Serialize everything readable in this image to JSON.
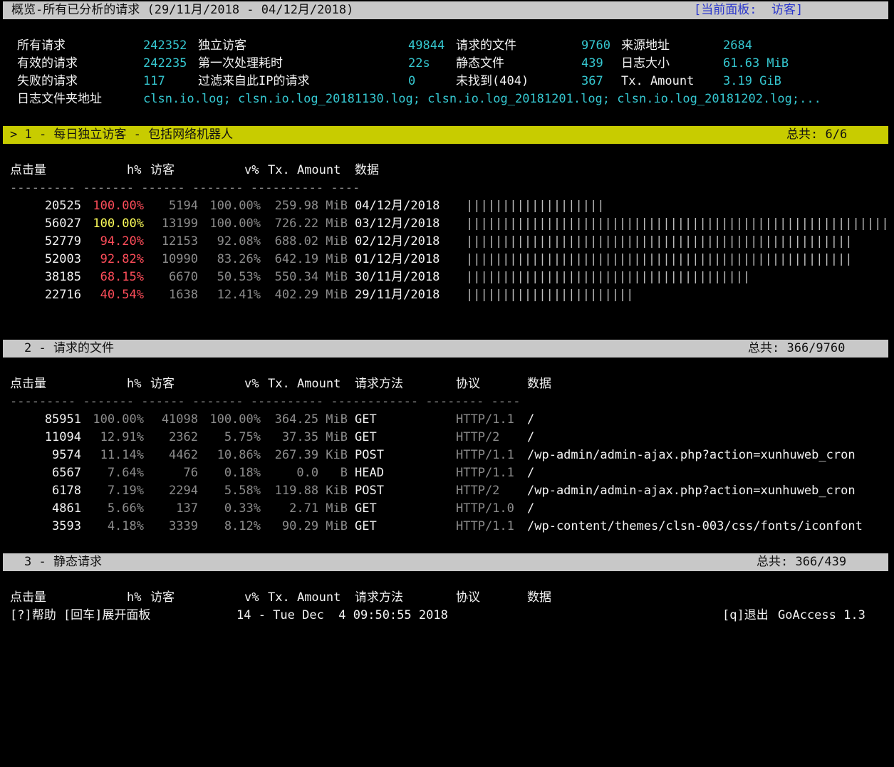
{
  "header": {
    "title": "概览-所有已分析的请求 (29/11月/2018 - 04/12月/2018)",
    "panel_label": "[当前面板:  访客]"
  },
  "overview": {
    "rows": [
      [
        {
          "label": "所有请求",
          "value": "242352"
        },
        {
          "label": "独立访客",
          "value": "49844"
        },
        {
          "label": "请求的文件",
          "value": "9760"
        },
        {
          "label": "来源地址",
          "value": "2684"
        }
      ],
      [
        {
          "label": "有效的请求",
          "value": "242235"
        },
        {
          "label": "第一次处理耗时",
          "value": "22s"
        },
        {
          "label": "静态文件",
          "value": "439"
        },
        {
          "label": "日志大小",
          "value": "61.63 MiB"
        }
      ],
      [
        {
          "label": "失败的请求",
          "value": "117"
        },
        {
          "label": "过滤来自此IP的请求",
          "value": "0"
        },
        {
          "label": "未找到(404)",
          "value": "367"
        },
        {
          "label": "Tx. Amount",
          "value": "3.19 GiB"
        }
      ]
    ],
    "log_label": "日志文件夹地址",
    "log_value": "clsn.io.log; clsn.io.log_20181130.log; clsn.io.log_20181201.log; clsn.io.log_20181202.log;..."
  },
  "panel1": {
    "title": "> 1 - 每日独立访客 - 包括网络机器人",
    "total": "总共: 6/6",
    "headers": {
      "hits": "点击量",
      "hpct": "h%",
      "visitors": "访客",
      "vpct": "v%",
      "tx": "Tx. Amount",
      "data": "数据"
    },
    "dashes": "--------- ------- ------ ------- ---------- ----",
    "rows": [
      {
        "hits": "20525",
        "hpct": "100.00%",
        "visitors": "5194",
        "vpct": "100.00%",
        "tx": "259.98 MiB",
        "date": "04/12月/2018",
        "bar": 0.33,
        "hcolor": "red"
      },
      {
        "hits": "56027",
        "hpct": "100.00%",
        "visitors": "13199",
        "vpct": "100.00%",
        "tx": "726.22 MiB",
        "date": "03/12月/2018",
        "bar": 1.0,
        "hcolor": "yellow"
      },
      {
        "hits": "52779",
        "hpct": "94.20%",
        "visitors": "12153",
        "vpct": "92.08%",
        "tx": "688.02 MiB",
        "date": "02/12月/2018",
        "bar": 0.92,
        "hcolor": "red"
      },
      {
        "hits": "52003",
        "hpct": "92.82%",
        "visitors": "10990",
        "vpct": "83.26%",
        "tx": "642.19 MiB",
        "date": "01/12月/2018",
        "bar": 0.92,
        "hcolor": "red"
      },
      {
        "hits": "38185",
        "hpct": "68.15%",
        "visitors": "6670",
        "vpct": "50.53%",
        "tx": "550.34 MiB",
        "date": "30/11月/2018",
        "bar": 0.68,
        "hcolor": "red"
      },
      {
        "hits": "22716",
        "hpct": "40.54%",
        "visitors": "1638",
        "vpct": "12.41%",
        "tx": "402.29 MiB",
        "date": "29/11月/2018",
        "bar": 0.39,
        "hcolor": "red"
      }
    ]
  },
  "panel2": {
    "title": "2 - 请求的文件",
    "total": "总共: 366/9760",
    "headers": {
      "hits": "点击量",
      "hpct": "h%",
      "visitors": "访客",
      "vpct": "v%",
      "tx": "Tx. Amount",
      "method": "请求方法",
      "protocol": "协议",
      "data": "数据"
    },
    "dashes": "--------- ------- ------ ------- ---------- ------------ -------- ----",
    "rows": [
      {
        "hits": "85951",
        "hpct": "100.00%",
        "visitors": "41098",
        "vpct": "100.00%",
        "tx": "364.25 MiB",
        "method": "GET",
        "protocol": "HTTP/1.1",
        "path": "/"
      },
      {
        "hits": "11094",
        "hpct": "12.91%",
        "visitors": "2362",
        "vpct": "5.75%",
        "tx": "37.35 MiB",
        "method": "GET",
        "protocol": "HTTP/2",
        "path": "/"
      },
      {
        "hits": "9574",
        "hpct": "11.14%",
        "visitors": "4462",
        "vpct": "10.86%",
        "tx": "267.39 KiB",
        "method": "POST",
        "protocol": "HTTP/1.1",
        "path": "/wp-admin/admin-ajax.php?action=xunhuweb_cron"
      },
      {
        "hits": "6567",
        "hpct": "7.64%",
        "visitors": "76",
        "vpct": "0.18%",
        "tx": "0.0   B",
        "method": "HEAD",
        "protocol": "HTTP/1.1",
        "path": "/"
      },
      {
        "hits": "6178",
        "hpct": "7.19%",
        "visitors": "2294",
        "vpct": "5.58%",
        "tx": "119.88 KiB",
        "method": "POST",
        "protocol": "HTTP/2",
        "path": "/wp-admin/admin-ajax.php?action=xunhuweb_cron"
      },
      {
        "hits": "4861",
        "hpct": "5.66%",
        "visitors": "137",
        "vpct": "0.33%",
        "tx": "2.71 MiB",
        "method": "GET",
        "protocol": "HTTP/1.0",
        "path": "/"
      },
      {
        "hits": "3593",
        "hpct": "4.18%",
        "visitors": "3339",
        "vpct": "8.12%",
        "tx": "90.29 MiB",
        "method": "GET",
        "protocol": "HTTP/1.1",
        "path": "/wp-content/themes/clsn-003/css/fonts/iconfont"
      }
    ]
  },
  "panel3": {
    "title": "3 - 静态请求",
    "total": "总共: 366/439",
    "headers": {
      "hits": "点击量",
      "hpct": "h%",
      "visitors": "访客",
      "vpct": "v%",
      "tx": "Tx. Amount",
      "method": "请求方法",
      "protocol": "协议",
      "data": "数据"
    }
  },
  "footer": {
    "help": "[?]帮助 [回车]展开面板",
    "status": "14 - Tue Dec  4 09:50:55 2018",
    "quit": "[q]退出",
    "version": "GoAccess 1.3"
  },
  "colors": {
    "cyan": "#35c7d0",
    "red": "#ff4d5a",
    "yellow": "#ffff5a",
    "gray": "#8c8c8c",
    "panel_blue": "#2a36cc",
    "bar_gray": "#c8c8c8",
    "bar_yellow": "#c8cc00"
  }
}
